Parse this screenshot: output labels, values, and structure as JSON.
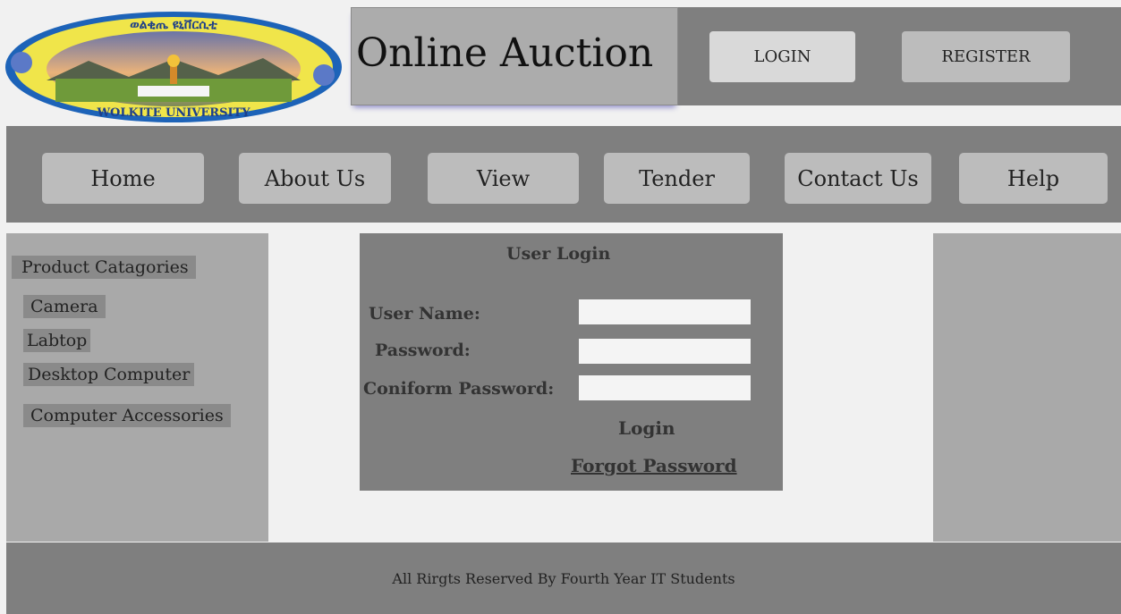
{
  "header": {
    "logo_top_text": "ወልቂጤ ዩኒቨርሲቲ",
    "logo_bottom_text": "WOLKITE UNIVERSITY",
    "title": "Online Auction",
    "login_label": "LOGIN",
    "register_label": "REGISTER"
  },
  "nav": {
    "items": [
      "Home",
      "About Us",
      "View",
      "Tender",
      "Contact Us",
      "Help"
    ]
  },
  "sidebar": {
    "heading": "Product Catagories",
    "categories": [
      "Camera",
      "Labtop",
      "Desktop Computer",
      "Computer Accessories"
    ]
  },
  "login_form": {
    "heading": "User Login",
    "username_label": "User Name:",
    "password_label": "Password:",
    "confirm_label": "Coniform Password:",
    "username_value": "",
    "password_value": "",
    "confirm_value": "",
    "login_label": "Login",
    "forgot_label": "Forgot Password"
  },
  "footer": {
    "text": "All Rirgts Reserved By Fourth Year IT Students"
  }
}
